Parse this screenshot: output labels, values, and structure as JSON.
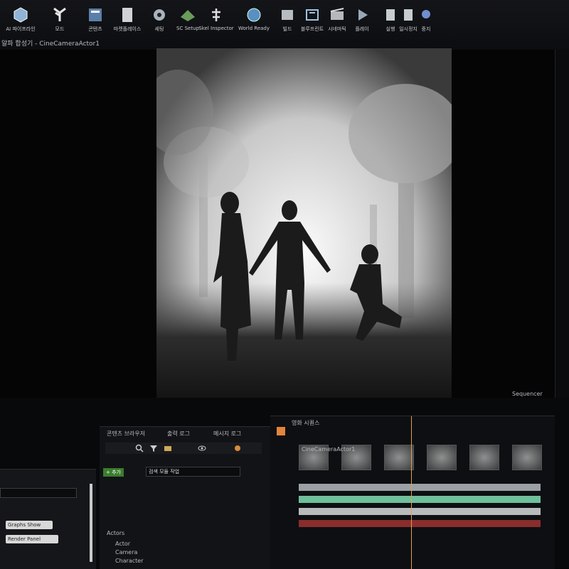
{
  "toolbar": {
    "buttons": [
      {
        "label": "AI 파이프라인",
        "icon": "cube-icon"
      },
      {
        "label": "모드",
        "icon": "modes-icon"
      },
      {
        "label": "콘텐츠",
        "icon": "content-icon"
      },
      {
        "label": "마켓플레이스",
        "icon": "marketplace-icon"
      },
      {
        "label": "세팅",
        "icon": "settings-icon"
      },
      {
        "label": "SC Setup",
        "icon": "setup-icon"
      },
      {
        "label": "Skel Inspector",
        "icon": "skeleton-icon"
      },
      {
        "label": "World Ready",
        "icon": "globe-icon"
      },
      {
        "label": "빌드",
        "icon": "build-icon"
      },
      {
        "label": "블루프린트",
        "icon": "blueprint-icon"
      },
      {
        "label": "시네마틱",
        "icon": "cinematics-icon"
      },
      {
        "label": "플레이",
        "icon": "play-icon"
      },
      {
        "label": "실행",
        "icon": "launch-icon"
      },
      {
        "label": "일시정지",
        "icon": "pause-icon"
      },
      {
        "label": "중지",
        "icon": "stop-icon"
      }
    ]
  },
  "viewport": {
    "tab_label": "알파 합성기 - CineCameraActor1"
  },
  "outliner": {
    "title": "콘텐츠 브라우저",
    "tab2": "출력 로그",
    "tab3": "메시지 로그",
    "search_placeholder": "검색 모듈 작업",
    "add_label": "+ 추가",
    "tree": [
      {
        "label": "Actors"
      },
      {
        "label": "Actor"
      },
      {
        "label": "Camera"
      },
      {
        "label": "Character"
      }
    ]
  },
  "details": {
    "buttons": [
      "Graphs Show",
      "Render Panel"
    ]
  },
  "sequencer": {
    "title": "Sequencer",
    "tab_label": "영화 시퀀스",
    "track_label": "CineCameraActor1",
    "tracks": [
      {
        "color": "#9aa1a6"
      },
      {
        "color": "#6fbf9c"
      },
      {
        "color": "#b9babc"
      },
      {
        "color": "#8a2d2d"
      }
    ]
  }
}
